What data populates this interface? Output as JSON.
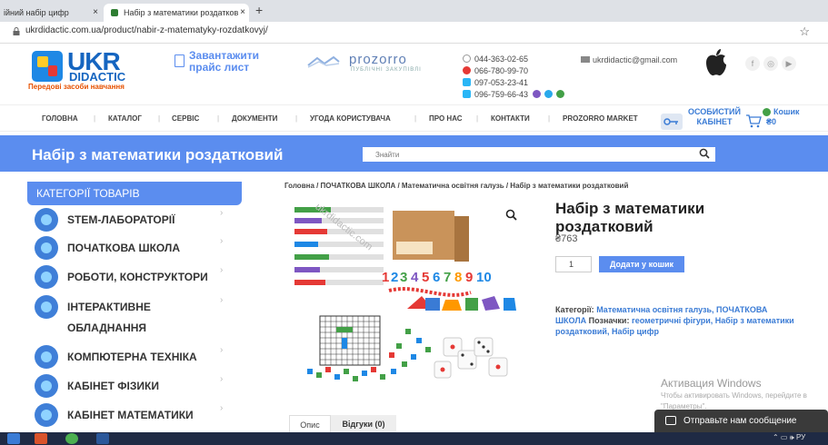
{
  "browser": {
    "tabs": [
      {
        "label": "ійний набір цифр"
      },
      {
        "label": "Набір з математики роздатков"
      }
    ],
    "close_symbol": "×",
    "new_tab_symbol": "+",
    "url": "ukrdidactic.com.ua/product/nabir-z-matematyky-rozdatkovyj/",
    "star_symbol": "☆"
  },
  "header": {
    "logo_main": "UKR",
    "logo_sub": "DIDACTIC",
    "tagline": "Передові засоби навчання",
    "price_list": "Завантажити прайс лист",
    "prozorro": "prozorro",
    "prozorro_sub": "ПУБЛІЧНІ ЗАКУПІВЛІ",
    "phones": [
      "044-363-02-65",
      "066-780-99-70",
      "097-053-23-41",
      "096-759-66-43"
    ],
    "email": "ukrdidactic@gmail.com",
    "social": [
      "f",
      "◎",
      "▶"
    ]
  },
  "nav": {
    "items": [
      "ГОЛОВНА",
      "КАТАЛОГ",
      "СЕРВІС",
      "ДОКУМЕНТИ",
      "УГОДА КОРИСТУВАЧА",
      "ПРО НАС",
      "КОНТАКТИ",
      "PROZORRO MARKET"
    ],
    "cabinet": "ОСОБИСТИЙ КАБІНЕТ",
    "cart": "Кошик",
    "cart_total": "₴0"
  },
  "band": {
    "title": "Набір з математики роздатковий",
    "search_placeholder": "Знайти",
    "search_icon": "search-icon"
  },
  "sidebar": {
    "heading": "КАТЕГОРІЇ ТОВАРІВ",
    "items": [
      {
        "label": "STEM-ЛАБОРАТОРІЇ"
      },
      {
        "label": "ПОЧАТКОВА ШКОЛА"
      },
      {
        "label": "РОБОТИ, КОНСТРУКТОРИ"
      },
      {
        "label": "ІНТЕРАКТИВНЕ"
      },
      {
        "label": "ОБЛАДНАННЯ"
      },
      {
        "label": "КОМПЮТЕРНА ТЕХНІКА"
      },
      {
        "label": "КАБІНЕТ ФІЗИКИ"
      },
      {
        "label": "КАБІНЕТ МАТЕМАТИКИ"
      }
    ],
    "chevron": "›"
  },
  "product": {
    "breadcrumb": "Головна / ПОЧАТКОВА ШКОЛА / Математична освітня галузь / Набір з математики роздатковий",
    "title": "Набір з математики роздатковий",
    "price": "₴763",
    "qty": "1",
    "add_to_cart": "Додати у кошик",
    "categories_label": "Категорії:",
    "categories": "Математична освітня галузь, ПОЧАТКОВА ШКОЛА",
    "tags_label": "Позначки:",
    "tags": "геометричні фігури, Набір з математики роздатковий, Набір цифр",
    "tabs": [
      "Опис",
      "Відгуки (0)"
    ],
    "zoom_symbol": "🔍",
    "watermark": "ukrdidactic.com"
  },
  "overlay": {
    "activation": "Активация Windows",
    "activation_sub": "Чтобы активировать Windows, перейдите в",
    "activation_sub2": "\"Параметры\".",
    "chat": "Отправьте нам сообщение"
  },
  "taskbar": {
    "tray": "⌃ ▭ 🕪 РУ"
  },
  "colors": {
    "accent": "#5b8def",
    "link": "#3a7bd5",
    "logo": "#1565c0",
    "taskbar": "#1f2a44"
  }
}
